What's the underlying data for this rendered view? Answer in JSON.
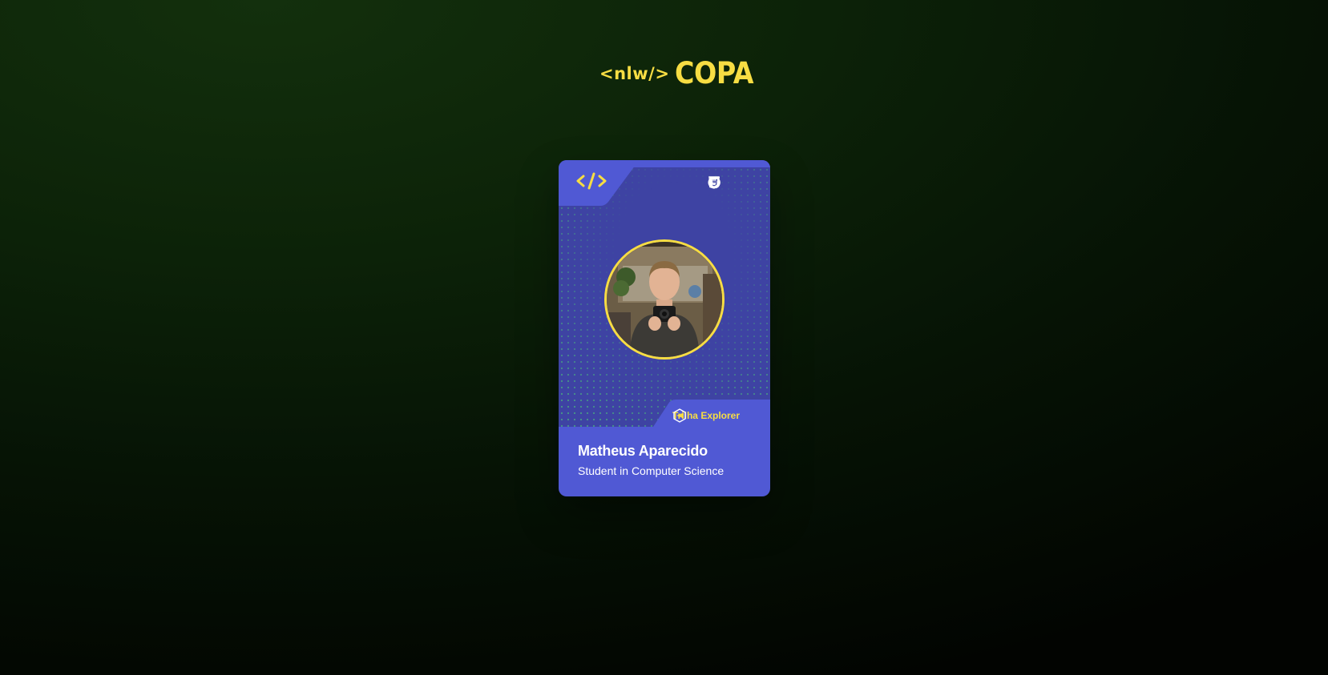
{
  "header": {
    "logo_prefix": "<nlw/>",
    "logo_title": "COPA"
  },
  "card": {
    "name": "Matheus Aparecido",
    "role": "Student in Computer Science",
    "track_label": "Trilha Explorer",
    "code_icon": "code-brackets-icon",
    "tech_icons": [
      "html5-icon",
      "css3-icon",
      "github-icon"
    ],
    "avatar_icon": "profile-photo",
    "colors": {
      "card": "#5059d4",
      "card_dark": "#3e43a3",
      "accent": "#f7dd43",
      "dots": "#4bb47e",
      "background": "#0c2208"
    }
  }
}
